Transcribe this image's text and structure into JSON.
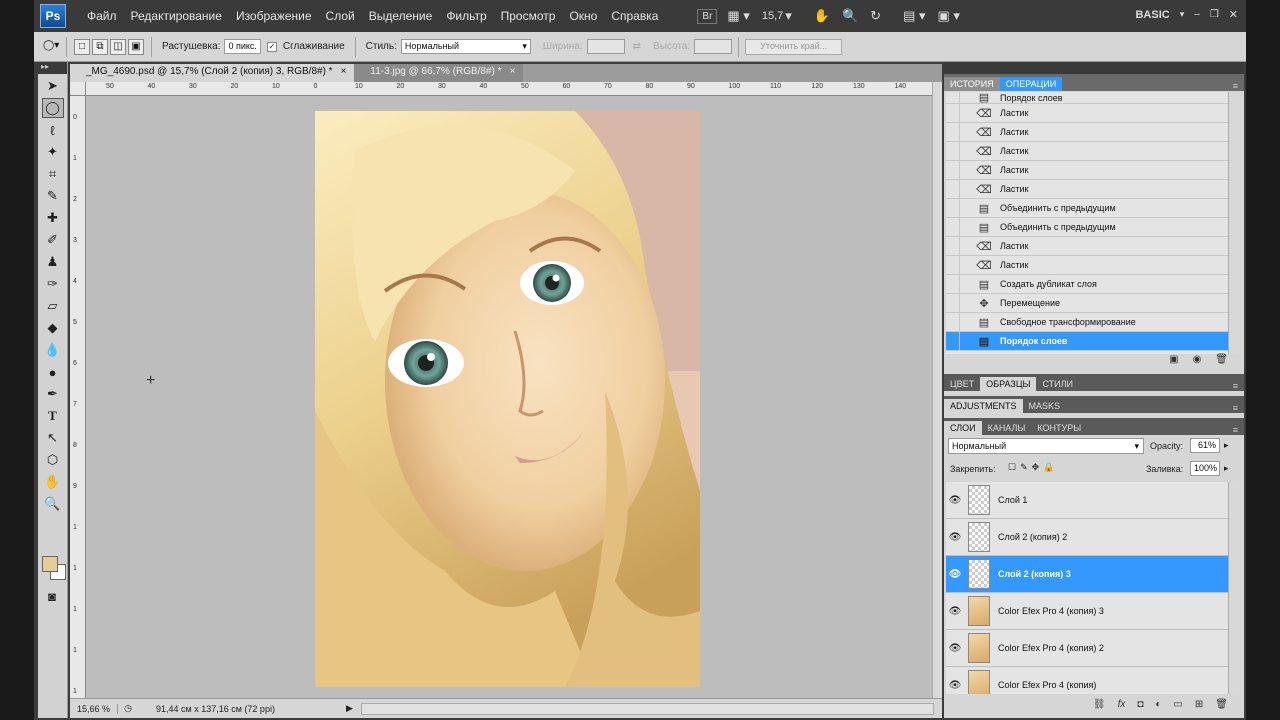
{
  "app": {
    "logo": "Ps",
    "menu": [
      "Файл",
      "Редактирование",
      "Изображение",
      "Слой",
      "Выделение",
      "Фильтр",
      "Просмотр",
      "Окно",
      "Справка"
    ],
    "bridge_label": "Br",
    "zoom_display": "15,7",
    "workspace": "BASIC"
  },
  "options": {
    "feather_label": "Растушевка:",
    "feather_value": "0 пикс.",
    "antialias_label": "Сглаживание",
    "style_label": "Стиль:",
    "style_value": "Нормальный",
    "width_label": "Ширина:",
    "height_label": "Высота:",
    "refine_label": "Уточнить край..."
  },
  "documents": {
    "tabs": [
      {
        "title": "_MG_4690.psd @ 15,7% (Слой 2 (копия) 3, RGB/8#) *",
        "close": "×"
      },
      {
        "title": "11-3.jpg @ 66,7% (RGB/8#) *",
        "close": "×"
      }
    ]
  },
  "ruler": {
    "h_ticks": [
      "50",
      "40",
      "30",
      "20",
      "10",
      "0",
      "10",
      "20",
      "30",
      "40",
      "50",
      "60",
      "70",
      "80",
      "90",
      "100",
      "110",
      "120",
      "130",
      "140"
    ],
    "v_ticks": [
      "0",
      "1",
      "2",
      "3",
      "4",
      "5",
      "6",
      "7",
      "8",
      "9",
      "1",
      "1",
      "1",
      "1",
      "1"
    ]
  },
  "status": {
    "zoom": "15,66 %",
    "doc_size": "91,44 см x 137,16 см (72 ppi)"
  },
  "history_panel": {
    "tabs": [
      "ИСТОРИЯ",
      "ОПЕРАЦИИ"
    ],
    "items": [
      {
        "label": "Порядок слоев",
        "icon": "doc-icon"
      },
      {
        "label": "Ластик",
        "icon": "eraser-icon"
      },
      {
        "label": "Ластик",
        "icon": "eraser-icon"
      },
      {
        "label": "Ластик",
        "icon": "eraser-icon"
      },
      {
        "label": "Ластик",
        "icon": "eraser-icon"
      },
      {
        "label": "Ластик",
        "icon": "eraser-icon"
      },
      {
        "label": "Объединить с предыдущим",
        "icon": "doc-icon"
      },
      {
        "label": "Объединить с предыдущим",
        "icon": "doc-icon"
      },
      {
        "label": "Ластик",
        "icon": "eraser-icon"
      },
      {
        "label": "Ластик",
        "icon": "eraser-icon"
      },
      {
        "label": "Создать дубликат слоя",
        "icon": "doc-icon"
      },
      {
        "label": "Перемещение",
        "icon": "move-icon"
      },
      {
        "label": "Свободное трансформирование",
        "icon": "doc-icon"
      },
      {
        "label": "Порядок слоев",
        "icon": "doc-icon",
        "selected": true
      }
    ]
  },
  "color_panel": {
    "tabs": [
      "ЦВЕТ",
      "ОБРАЗЦЫ",
      "СТИЛИ"
    ]
  },
  "adjust_panel": {
    "tabs": [
      "ADJUSTMENTS",
      "MASKS"
    ]
  },
  "layers_panel": {
    "tabs": [
      "СЛОИ",
      "КАНАЛЫ",
      "КОНТУРЫ"
    ],
    "blend_mode": "Нормальный",
    "opacity_label": "Opacity:",
    "opacity_value": "61%",
    "lock_label": "Закрепить:",
    "fill_label": "Заливка:",
    "fill_value": "100%",
    "layers": [
      {
        "name": "Слой 1",
        "thumb": "trans",
        "selected": false
      },
      {
        "name": "Слой 2 (копия) 2",
        "thumb": "trans",
        "selected": false
      },
      {
        "name": "Слой 2 (копия) 3",
        "thumb": "trans",
        "selected": true
      },
      {
        "name": "Color Efex Pro 4 (копия) 3",
        "thumb": "face",
        "selected": false
      },
      {
        "name": "Color Efex Pro 4 (копия) 2",
        "thumb": "face",
        "selected": false
      },
      {
        "name": "Color Efex Pro 4 (копия)",
        "thumb": "face",
        "selected": false
      }
    ]
  },
  "colors": {
    "selection": "#3399ff",
    "foreground": "#e6cc96",
    "background": "#ffffff"
  }
}
